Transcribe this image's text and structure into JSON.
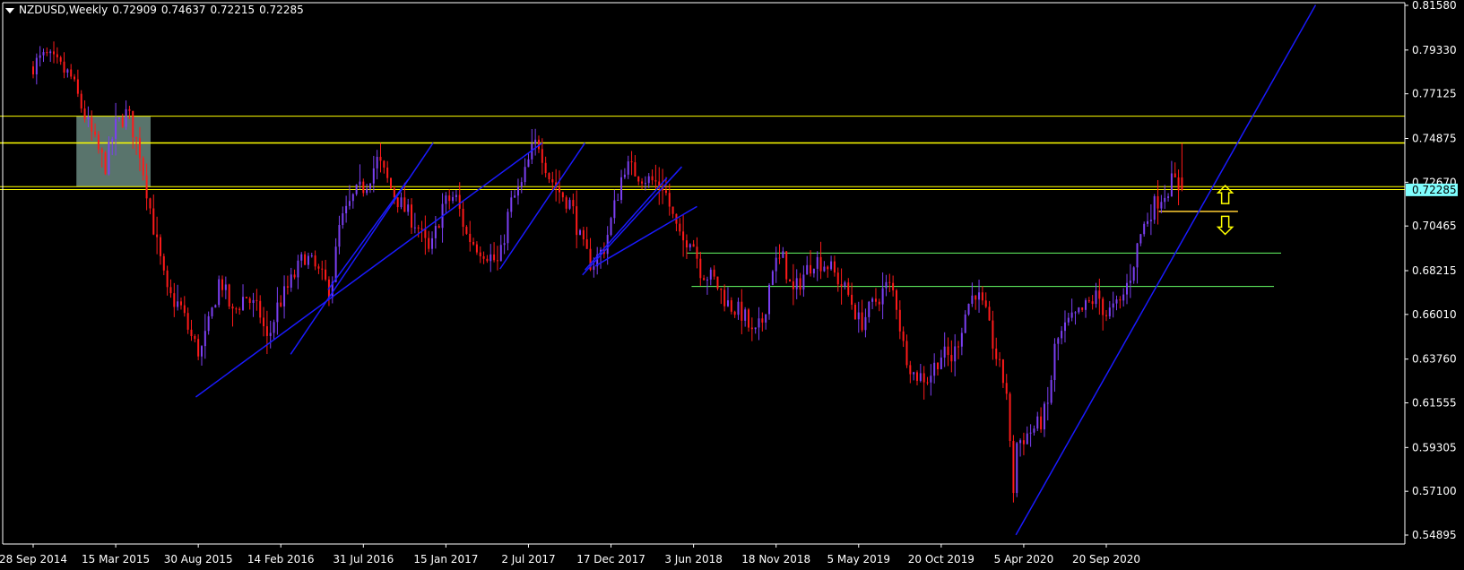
{
  "header": {
    "symbol": "NZDUSD,Weekly",
    "open": "0.72909",
    "high": "0.74637",
    "low": "0.72215",
    "close": "0.72285"
  },
  "colors": {
    "background": "#000000",
    "axis": "#ffffff",
    "bull_candle": "#7b3ff2",
    "bear_candle": "#ff1a1a",
    "trendline": "#1a1aff",
    "resistance": "#ffff00",
    "support": "#66ff66",
    "price_tag": "#7fffff",
    "zone": "#8fbcae"
  },
  "chart_data": {
    "type": "candlestick",
    "title": "NZDUSD,Weekly",
    "timeframe": "Weekly",
    "last_price": "0.72285",
    "ylim": [
      0.5435,
      0.8158
    ],
    "yticks": [
      "0.81580",
      "0.79330",
      "0.77125",
      "0.74875",
      "0.72670",
      "0.70465",
      "0.68215",
      "0.66010",
      "0.63760",
      "0.61555",
      "0.59305",
      "0.57100",
      "0.54895"
    ],
    "xticks": [
      "28 Sep 2014",
      "15 Mar 2015",
      "30 Aug 2015",
      "14 Feb 2016",
      "31 Jul 2016",
      "15 Jan 2017",
      "2 Jul 2017",
      "17 Dec 2017",
      "3 Jun 2018",
      "18 Nov 2018",
      "5 May 2019",
      "20 Oct 2019",
      "5 Apr 2020",
      "20 Sep 2020"
    ],
    "price_path": [
      [
        "2014-09-28",
        0.785
      ],
      [
        "2014-11-01",
        0.79
      ],
      [
        "2014-12-20",
        0.78
      ],
      [
        "2015-01-15",
        0.762
      ],
      [
        "2015-02-10",
        0.745
      ],
      [
        "2015-03-01",
        0.735
      ],
      [
        "2015-03-20",
        0.754
      ],
      [
        "2015-04-15",
        0.762
      ],
      [
        "2015-05-10",
        0.742
      ],
      [
        "2015-06-10",
        0.7
      ],
      [
        "2015-07-05",
        0.67
      ],
      [
        "2015-08-01",
        0.664
      ],
      [
        "2015-08-20",
        0.65
      ],
      [
        "2015-09-10",
        0.64
      ],
      [
        "2015-10-01",
        0.658
      ],
      [
        "2015-10-20",
        0.679
      ],
      [
        "2015-11-15",
        0.66
      ],
      [
        "2015-12-10",
        0.67
      ],
      [
        "2016-01-10",
        0.66
      ],
      [
        "2016-01-25",
        0.646
      ],
      [
        "2016-02-14",
        0.664
      ],
      [
        "2016-03-10",
        0.675
      ],
      [
        "2016-04-10",
        0.69
      ],
      [
        "2016-05-10",
        0.68
      ],
      [
        "2016-06-01",
        0.672
      ],
      [
        "2016-06-20",
        0.705
      ],
      [
        "2016-07-20",
        0.72
      ],
      [
        "2016-08-10",
        0.725
      ],
      [
        "2016-09-05",
        0.738
      ],
      [
        "2016-10-05",
        0.722
      ],
      [
        "2016-11-01",
        0.712
      ],
      [
        "2016-11-25",
        0.705
      ],
      [
        "2016-12-20",
        0.69
      ],
      [
        "2017-01-15",
        0.715
      ],
      [
        "2017-02-10",
        0.72
      ],
      [
        "2017-03-05",
        0.7
      ],
      [
        "2017-03-25",
        0.695
      ],
      [
        "2017-04-20",
        0.69
      ],
      [
        "2017-05-10",
        0.685
      ],
      [
        "2017-06-01",
        0.715
      ],
      [
        "2017-06-25",
        0.725
      ],
      [
        "2017-07-15",
        0.742
      ],
      [
        "2017-07-28",
        0.748
      ],
      [
        "2017-08-20",
        0.73
      ],
      [
        "2017-09-10",
        0.722
      ],
      [
        "2017-10-05",
        0.715
      ],
      [
        "2017-10-25",
        0.695
      ],
      [
        "2017-11-15",
        0.685
      ],
      [
        "2017-12-10",
        0.694
      ],
      [
        "2017-12-25",
        0.708
      ],
      [
        "2018-01-20",
        0.735
      ],
      [
        "2018-02-10",
        0.732
      ],
      [
        "2018-03-10",
        0.728
      ],
      [
        "2018-04-10",
        0.725
      ],
      [
        "2018-04-25",
        0.712
      ],
      [
        "2018-05-15",
        0.696
      ],
      [
        "2018-06-05",
        0.7
      ],
      [
        "2018-06-25",
        0.682
      ],
      [
        "2018-07-20",
        0.678
      ],
      [
        "2018-08-20",
        0.665
      ],
      [
        "2018-09-20",
        0.66
      ],
      [
        "2018-10-10",
        0.648
      ],
      [
        "2018-10-30",
        0.658
      ],
      [
        "2018-11-18",
        0.685
      ],
      [
        "2018-12-10",
        0.688
      ],
      [
        "2018-12-28",
        0.67
      ],
      [
        "2019-01-20",
        0.68
      ],
      [
        "2019-02-10",
        0.688
      ],
      [
        "2019-03-10",
        0.685
      ],
      [
        "2019-04-05",
        0.676
      ],
      [
        "2019-04-25",
        0.668
      ],
      [
        "2019-05-15",
        0.655
      ],
      [
        "2019-06-10",
        0.665
      ],
      [
        "2019-07-10",
        0.675
      ],
      [
        "2019-07-25",
        0.67
      ],
      [
        "2019-08-10",
        0.645
      ],
      [
        "2019-09-01",
        0.63
      ],
      [
        "2019-10-01",
        0.628
      ],
      [
        "2019-10-25",
        0.64
      ],
      [
        "2019-11-20",
        0.638
      ],
      [
        "2019-12-20",
        0.665
      ],
      [
        "2020-01-05",
        0.672
      ],
      [
        "2020-01-25",
        0.66
      ],
      [
        "2020-02-20",
        0.635
      ],
      [
        "2020-03-10",
        0.62
      ],
      [
        "2020-03-20",
        0.565
      ],
      [
        "2020-03-28",
        0.595
      ],
      [
        "2020-04-20",
        0.6
      ],
      [
        "2020-05-15",
        0.605
      ],
      [
        "2020-06-01",
        0.615
      ],
      [
        "2020-06-15",
        0.645
      ],
      [
        "2020-07-10",
        0.655
      ],
      [
        "2020-08-10",
        0.662
      ],
      [
        "2020-09-10",
        0.67
      ],
      [
        "2020-09-25",
        0.66
      ],
      [
        "2020-10-25",
        0.665
      ],
      [
        "2020-11-15",
        0.68
      ],
      [
        "2020-12-05",
        0.7
      ],
      [
        "2020-12-25",
        0.712
      ],
      [
        "2021-01-10",
        0.718
      ],
      [
        "2021-01-25",
        0.722
      ],
      [
        "2021-02-10",
        0.728
      ],
      [
        "2021-02-25",
        0.72285
      ]
    ],
    "annotations": {
      "resistance_levels": [
        0.76,
        0.7465,
        0.7245,
        0.723
      ],
      "support_levels": [
        0.712,
        0.691,
        0.6742
      ],
      "zone": {
        "from": "2014-12-25",
        "to": "2015-05-25",
        "low": 0.7245,
        "high": 0.76
      },
      "trendlines": [
        {
          "from": [
            "2015-08-25",
            0.6185
          ],
          "to": [
            "2017-07-30",
            0.7465
          ]
        },
        {
          "from": [
            "2016-03-05",
            0.64
          ],
          "to": [
            "2016-12-20",
            0.7465
          ]
        },
        {
          "from": [
            "2016-05-20",
            0.6725
          ],
          "to": [
            "2016-10-30",
            0.728
          ]
        },
        {
          "from": [
            "2017-05-05",
            0.683
          ],
          "to": [
            "2017-10-25",
            0.7465
          ]
        },
        {
          "from": [
            "2017-10-20",
            0.68
          ],
          "to": [
            "2018-05-10",
            0.7345
          ]
        },
        {
          "from": [
            "2017-10-25",
            0.6825
          ],
          "to": [
            "2018-04-10",
            0.729
          ]
        },
        {
          "from": [
            "2017-11-15",
            0.6845
          ],
          "to": [
            "2018-06-10",
            0.7145
          ]
        },
        {
          "from": [
            "2020-03-20",
            0.549
          ],
          "to": [
            "2021-11-20",
            0.816
          ]
        }
      ],
      "arrows": [
        {
          "date": "2021-05-20",
          "price": 0.7205,
          "direction": "up"
        },
        {
          "date": "2021-05-20",
          "price": 0.705,
          "direction": "down"
        }
      ]
    }
  }
}
